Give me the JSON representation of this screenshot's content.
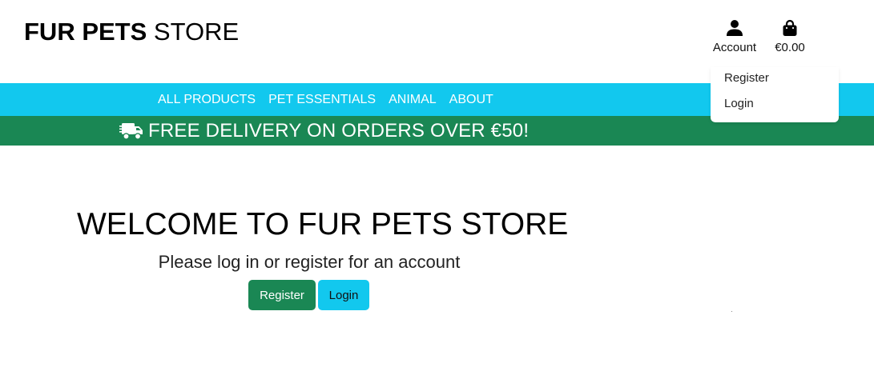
{
  "header": {
    "logo_bold": "FUR PETS",
    "logo_light": "STORE",
    "account_label": "Account",
    "account_icon": "user-icon",
    "cart_total": "€0.00",
    "cart_icon": "shopping-bag-icon"
  },
  "account_menu": {
    "items": [
      "Register",
      "Login"
    ]
  },
  "nav": {
    "links": [
      "ALL PRODUCTS",
      "PET ESSENTIALS",
      "ANIMAL",
      "ABOUT"
    ]
  },
  "promo": {
    "icon": "truck-icon",
    "text": "FREE DELIVERY ON ORDERS OVER €50!"
  },
  "main": {
    "title": "WELCOME TO FUR PETS STORE",
    "subtitle": "Please log in or register for an account",
    "register_button": "Register",
    "login_button": "Login"
  },
  "colors": {
    "nav_bg": "#12c8ee",
    "promo_bg": "#1a8754",
    "register_button_bg": "#1a8754",
    "login_button_bg": "#12c8ee"
  }
}
